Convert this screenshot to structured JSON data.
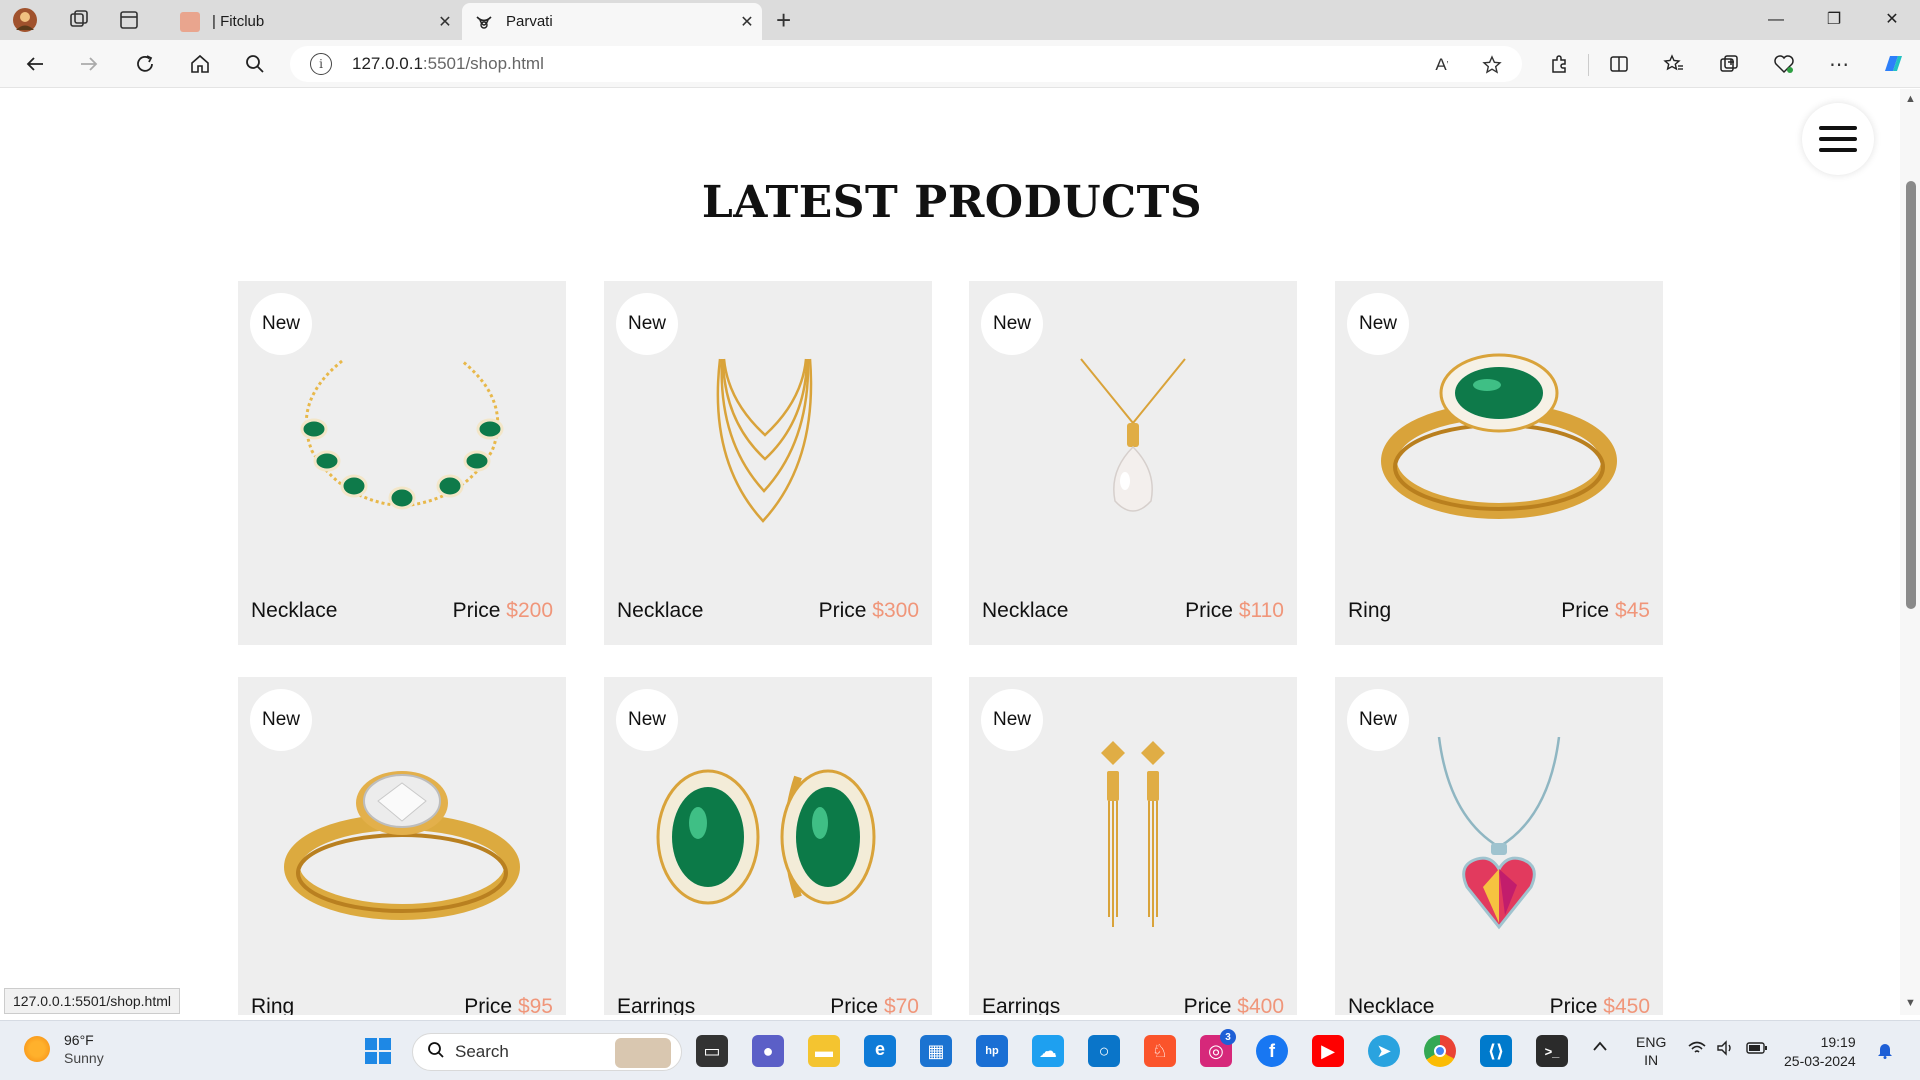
{
  "browser": {
    "tabs": [
      {
        "title": "| Fitclub",
        "active": false
      },
      {
        "title": "Parvati",
        "active": true
      }
    ],
    "url_host": "127.0.0.1",
    "url_rest": ":5501/shop.html",
    "status_url": "127.0.0.1:5501/shop.html"
  },
  "page": {
    "title": "LATEST PRODUCTS",
    "price_label": "Price",
    "products": [
      {
        "badge": "New",
        "name": "Necklace",
        "price": "$200",
        "image": "emerald-necklace"
      },
      {
        "badge": "New",
        "name": "Necklace",
        "price": "$300",
        "image": "gold-chain-necklace"
      },
      {
        "badge": "New",
        "name": "Necklace",
        "price": "$110",
        "image": "pearl-pendant-necklace"
      },
      {
        "badge": "New",
        "name": "Ring",
        "price": "$45",
        "image": "emerald-ring"
      },
      {
        "badge": "New",
        "name": "Ring",
        "price": "$95",
        "image": "diamond-ring"
      },
      {
        "badge": "New",
        "name": "Earrings",
        "price": "$70",
        "image": "emerald-earrings"
      },
      {
        "badge": "New",
        "name": "Earrings",
        "price": "$400",
        "image": "gold-drop-earrings"
      },
      {
        "badge": "New",
        "name": "Necklace",
        "price": "$450",
        "image": "heart-pendant-necklace"
      }
    ]
  },
  "taskbar": {
    "weather_temp": "96°F",
    "weather_cond": "Sunny",
    "search_label": "Search",
    "lang_top": "ENG",
    "lang_bottom": "IN",
    "time": "19:19",
    "date": "25-03-2024",
    "instagram_badge": "3"
  },
  "colors": {
    "accent_price": "#f0967a",
    "card_bg": "#eeeeee"
  }
}
